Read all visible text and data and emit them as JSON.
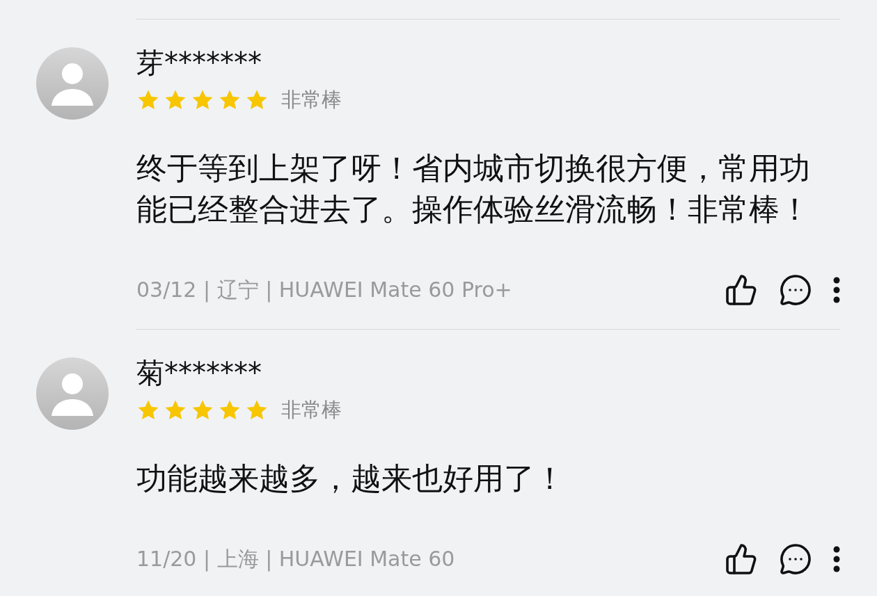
{
  "reviews": [
    {
      "user": "芽*******",
      "stars": 5,
      "rating_label": "非常棒",
      "text": "终于等到上架了呀！省内城市切换很方便，常用功能已经整合进去了。操作体验丝滑流畅！非常棒！",
      "meta": "03/12 | 辽宁 | HUAWEI Mate 60 Pro+"
    },
    {
      "user": "菊*******",
      "stars": 5,
      "rating_label": "非常棒",
      "text": "功能越来越多，越来也好用了！",
      "meta": "11/20 | 上海 | HUAWEI Mate 60"
    }
  ]
}
